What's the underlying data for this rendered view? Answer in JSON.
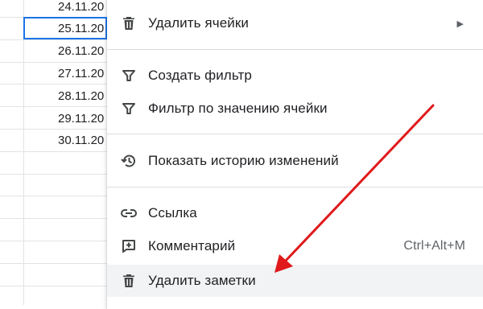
{
  "sheet": {
    "dates": [
      "24.11.20",
      "25.11.20",
      "26.11.20",
      "27.11.20",
      "28.11.20",
      "29.11.20",
      "30.11.20"
    ]
  },
  "menu": {
    "delete_cells": "Удалить ячейки",
    "create_filter": "Создать фильтр",
    "filter_by_value": "Фильтр по значению ячейки",
    "show_history": "Показать историю изменений",
    "link": "Ссылка",
    "comment": "Комментарий",
    "comment_shortcut": "Ctrl+Alt+M",
    "delete_notes": "Удалить заметки",
    "submenu_arrow": "▶"
  },
  "colors": {
    "selection": "#1a73e8",
    "annotation_arrow": "#e0191b",
    "hover_bg": "#f1f3f4"
  },
  "icons": [
    "trash-icon",
    "filter-icon",
    "history-icon",
    "link-icon",
    "add-comment-icon"
  ]
}
